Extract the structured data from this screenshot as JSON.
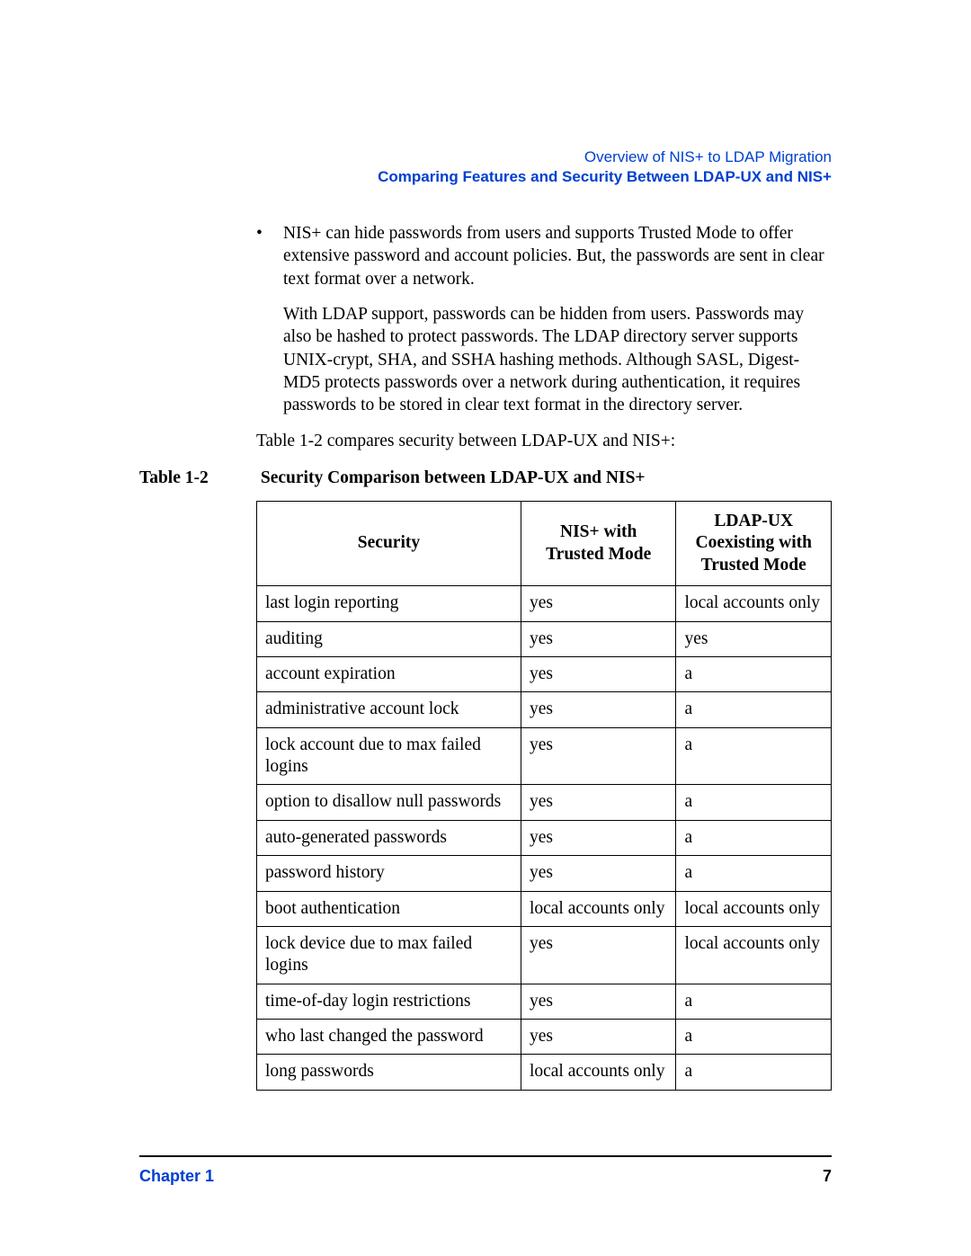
{
  "header": {
    "line1": "Overview of NIS+ to LDAP Migration",
    "line2": "Comparing Features and Security Between LDAP-UX and NIS+"
  },
  "bullet": {
    "dot": "•",
    "text": "NIS+ can hide passwords from users and supports Trusted Mode to offer extensive password and account policies. But, the passwords are sent in clear text format over a network."
  },
  "sub_para": "With LDAP support, passwords can be hidden from users. Passwords may also be hashed to protect passwords. The LDAP directory server supports UNIX-crypt, SHA, and SSHA hashing methods. Although SASL, Digest-MD5 protects passwords over a network during authentication, it requires passwords to be stored in clear text format in the directory server.",
  "intro_line": "Table 1-2 compares security between LDAP-UX and NIS+:",
  "table_caption": {
    "label": "Table 1-2",
    "title": "Security Comparison between LDAP-UX and NIS+"
  },
  "table": {
    "headers": {
      "c1": "Security",
      "c2": "NIS+ with Trusted Mode",
      "c3": "LDAP-UX Coexisting with Trusted Mode"
    },
    "rows": [
      {
        "c1": "last login reporting",
        "c2": "yes",
        "c3": "local accounts only"
      },
      {
        "c1": "auditing",
        "c2": "yes",
        "c3": "yes"
      },
      {
        "c1": "account expiration",
        "c2": "yes",
        "c3": "a"
      },
      {
        "c1": "administrative account lock",
        "c2": "yes",
        "c3": "a"
      },
      {
        "c1": "lock account due to max failed logins",
        "c2": "yes",
        "c3": "a"
      },
      {
        "c1": "option to disallow null passwords",
        "c2": "yes",
        "c3": "a"
      },
      {
        "c1": "auto-generated passwords",
        "c2": "yes",
        "c3": "a"
      },
      {
        "c1": "password history",
        "c2": "yes",
        "c3": "a"
      },
      {
        "c1": "boot authentication",
        "c2": "local accounts only",
        "c3": "local accounts only"
      },
      {
        "c1": "lock device due to max failed logins",
        "c2": "yes",
        "c3": "local accounts only"
      },
      {
        "c1": "time-of-day login restrictions",
        "c2": "yes",
        "c3": "a"
      },
      {
        "c1": "who last changed the password",
        "c2": "yes",
        "c3": "a"
      },
      {
        "c1": "long passwords",
        "c2": "local accounts only",
        "c3": "a"
      }
    ]
  },
  "footer": {
    "chapter": "Chapter 1",
    "page": "7"
  }
}
